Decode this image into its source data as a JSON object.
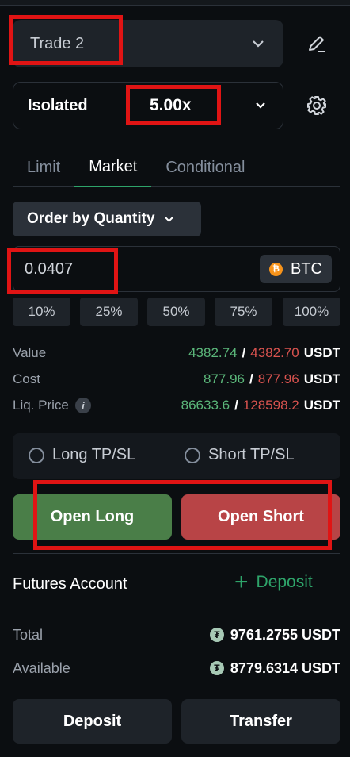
{
  "trade_selector": {
    "label": "Trade 2"
  },
  "margin": {
    "mode": "Isolated",
    "leverage": "5.00x"
  },
  "tabs": [
    {
      "label": "Limit",
      "active": false
    },
    {
      "label": "Market",
      "active": true
    },
    {
      "label": "Conditional",
      "active": false
    }
  ],
  "order_by": {
    "label": "Order by Quantity"
  },
  "quantity": {
    "value": "0.0407",
    "coin": "BTC"
  },
  "percent_buttons": [
    "10%",
    "25%",
    "50%",
    "75%",
    "100%"
  ],
  "info": {
    "value": {
      "label": "Value",
      "long": "4382.74",
      "short": "4382.70",
      "unit": "USDT"
    },
    "cost": {
      "label": "Cost",
      "long": "877.96",
      "short": "877.96",
      "unit": "USDT"
    },
    "liq_price": {
      "label": "Liq. Price",
      "long": "86633.6",
      "short": "128598.2",
      "unit": "USDT",
      "info_glyph": "i"
    },
    "separator": "/"
  },
  "tpsl": {
    "long_label": "Long TP/SL",
    "short_label": "Short TP/SL"
  },
  "actions": {
    "open_long": "Open Long",
    "open_short": "Open Short"
  },
  "futures_account": {
    "title": "Futures Account",
    "deposit_link": "Deposit",
    "total": {
      "label": "Total",
      "value": "9761.2755 USDT"
    },
    "available": {
      "label": "Available",
      "value": "8779.6314 USDT"
    },
    "usdt_glyph": "₮"
  },
  "bottom_buttons": {
    "deposit": "Deposit",
    "transfer": "Transfer"
  },
  "colors": {
    "long": "#4a7e48",
    "short": "#b84446",
    "accent": "#2ea46a",
    "highlight": "#e01414"
  }
}
